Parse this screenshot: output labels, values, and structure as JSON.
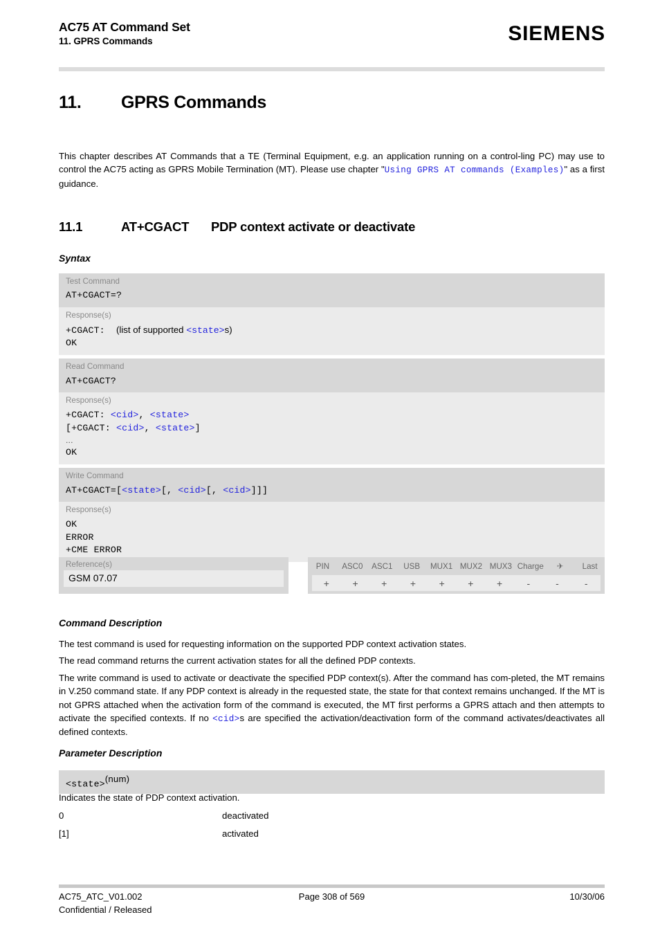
{
  "header": {
    "doc_title": "AC75 AT Command Set",
    "doc_subtitle": "11. GPRS Commands",
    "brand": "SIEMENS"
  },
  "chapter": {
    "number": "11.",
    "title": "GPRS Commands",
    "intro_part1": "This chapter describes AT Commands that a TE (Terminal Equipment, e.g. an application running on a control-ling PC) may use to control the AC75 acting as GPRS Mobile Termination (MT). Please use chapter \"",
    "intro_link": "Using GPRS AT commands (Examples)",
    "intro_part2": "\" as a first guidance."
  },
  "section": {
    "number": "11.1",
    "command": "AT+CGACT",
    "title": "PDP context activate or deactivate",
    "syntax_heading": "Syntax",
    "command_description_heading": "Command Description",
    "parameter_description_heading": "Parameter Description"
  },
  "syntax": {
    "blocks": [
      {
        "command_label": "Test Command",
        "command_code": "AT+CGACT=?",
        "response_label": "Response(s)",
        "response_lines": [
          "+CGACT:  (list of supported <state>s)",
          "OK"
        ]
      },
      {
        "command_label": "Read Command",
        "command_code": "AT+CGACT?",
        "response_label": "Response(s)",
        "response_lines": [
          "+CGACT: <cid>, <state>",
          "[+CGACT: <cid>, <state>]",
          "...",
          "OK"
        ]
      },
      {
        "command_label": "Write Command",
        "command_code": "AT+CGACT=[<state>[, <cid>[, <cid>]]]",
        "response_label": "Response(s)",
        "response_lines": [
          "OK",
          "ERROR",
          "+CME ERROR"
        ]
      }
    ]
  },
  "reference": {
    "label": "Reference(s)",
    "value": "GSM 07.07"
  },
  "capabilities": {
    "columns": [
      "PIN",
      "ASC0",
      "ASC1",
      "USB",
      "MUX1",
      "MUX2",
      "MUX3",
      "Charge",
      "✈",
      "Last"
    ],
    "values": [
      "+",
      "+",
      "+",
      "+",
      "+",
      "+",
      "+",
      "-",
      "-",
      "-"
    ]
  },
  "command_description": {
    "paragraphs": [
      "The test command is used for requesting information on the supported PDP context activation states.",
      "The read command returns the current activation states for all the defined PDP contexts.",
      "The write command is used to activate or deactivate the specified PDP context(s). After the command has com-pleted, the MT remains in V.250 command state. If any PDP context is already in the requested state, the state for that context remains unchanged. If the MT is not GPRS attached when the activation form of the command is executed, the MT first performs a GPRS attach and then attempts to activate the specified contexts. If no "
    ],
    "write_link": "<cid>",
    "write_tail": "s are specified the activation/deactivation form of the command activates/deactivates all defined contexts."
  },
  "parameter": {
    "name": "<state>",
    "type_suffix": "(num)",
    "description": "Indicates the state of PDP context activation.",
    "values": [
      {
        "key": "0",
        "meaning": "deactivated"
      },
      {
        "key": "[1]",
        "meaning": "activated"
      }
    ]
  },
  "footer": {
    "doc_id": "AC75_ATC_V01.002",
    "page": "Page 308 of 569",
    "date": "10/30/06",
    "classification": "Confidential / Released"
  }
}
